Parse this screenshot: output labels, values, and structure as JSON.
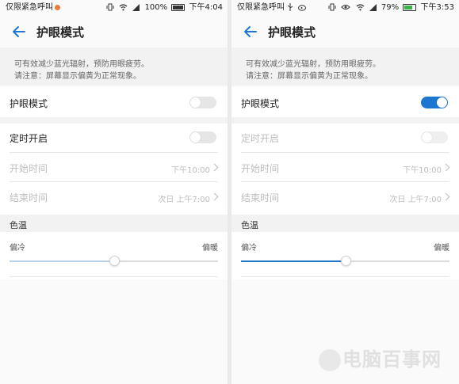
{
  "left": {
    "status": {
      "carrier": "仅限紧急呼叫",
      "battery": "100%",
      "time": "下午4:04",
      "battery_level": 1.0
    },
    "title": "护眼模式",
    "desc_line1": "可有效减少蓝光辐射，预防用眼疲劳。",
    "desc_line2": "请注意：屏幕显示偏黄为正常现象。",
    "eye_mode_label": "护眼模式",
    "eye_mode_on": false,
    "schedule_label": "定时开启",
    "schedule_on": false,
    "start_label": "开始时间",
    "start_value": "下午10:00",
    "end_label": "结束时间",
    "end_value": "次日 上午7:00",
    "temp_section": "色温",
    "temp_cool": "偏冷",
    "temp_warm": "偏暖",
    "temp_level": 0.5
  },
  "right": {
    "status": {
      "carrier": "仅限紧急呼叫",
      "battery": "79%",
      "time": "下午3:53",
      "battery_level": 0.79
    },
    "title": "护眼模式",
    "desc_line1": "可有效减少蓝光辐射，预防用眼疲劳。",
    "desc_line2": "请注意：屏幕显示偏黄为正常现象。",
    "eye_mode_label": "护眼模式",
    "eye_mode_on": true,
    "schedule_label": "定时开启",
    "schedule_on": false,
    "start_label": "开始时间",
    "start_value": "下午10:00",
    "end_label": "结束时间",
    "end_value": "次日 上午7:00",
    "temp_section": "色温",
    "temp_cool": "偏冷",
    "temp_warm": "偏暖",
    "temp_level": 0.5
  },
  "watermark": "电脑百事网",
  "colors": {
    "accent": "#1c76d2",
    "track_fill_left": "#b9d3ee",
    "track_fill_right": "#1c76d2"
  }
}
